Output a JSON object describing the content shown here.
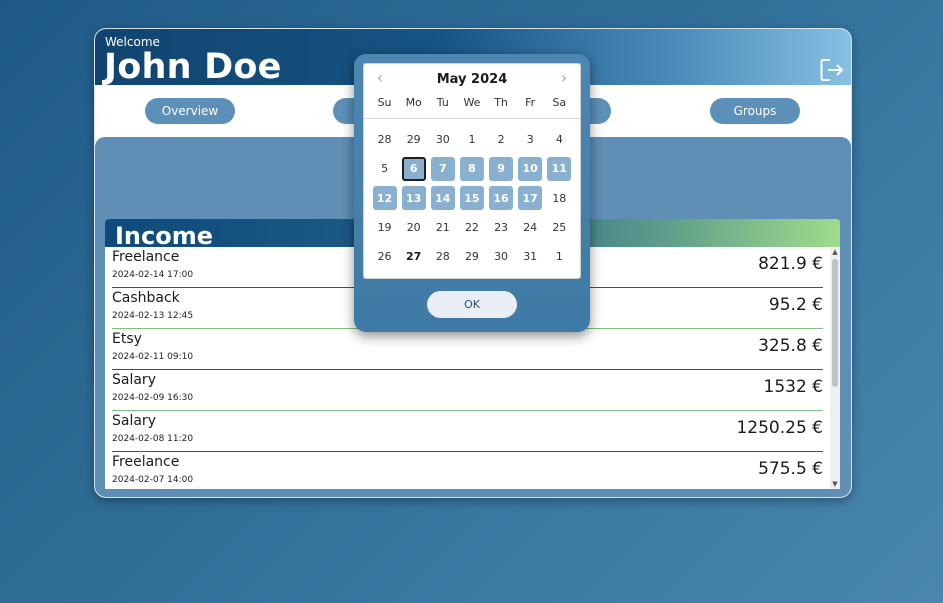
{
  "header": {
    "welcome": "Welcome",
    "username": "John Doe",
    "logout_icon": "logout-icon"
  },
  "nav": {
    "items": [
      {
        "label": "Overview"
      },
      {
        "label": ""
      },
      {
        "label": ""
      },
      {
        "label": "Groups"
      }
    ]
  },
  "income": {
    "title": "Income",
    "rows": [
      {
        "name": "Freelance",
        "date": "2024-02-14 17:00",
        "amount": "821.9 €"
      },
      {
        "name": "Cashback",
        "date": "2024-02-13 12:45",
        "amount": "95.2 €"
      },
      {
        "name": "Etsy",
        "date": "2024-02-11 09:10",
        "amount": "325.8 €"
      },
      {
        "name": "Salary",
        "date": "2024-02-09 16:30",
        "amount": "1532 €"
      },
      {
        "name": "Salary",
        "date": "2024-02-08 11:20",
        "amount": "1250.25 €"
      },
      {
        "name": "Freelance",
        "date": "2024-02-07 14:00",
        "amount": "575.5 €"
      }
    ]
  },
  "datepicker": {
    "month_label": "May 2024",
    "prev_icon": "chevron-left-icon",
    "next_icon": "chevron-right-icon",
    "weekdays": [
      "Su",
      "Mo",
      "Tu",
      "We",
      "Th",
      "Fr",
      "Sa"
    ],
    "weeks": [
      [
        "28",
        "29",
        "30",
        "1",
        "2",
        "3",
        "4"
      ],
      [
        "5",
        "6",
        "7",
        "8",
        "9",
        "10",
        "11"
      ],
      [
        "12",
        "13",
        "14",
        "15",
        "16",
        "17",
        "18"
      ],
      [
        "19",
        "20",
        "21",
        "22",
        "23",
        "24",
        "25"
      ],
      [
        "26",
        "27",
        "28",
        "29",
        "30",
        "31",
        "1"
      ]
    ],
    "selected_range": [
      "6",
      "7",
      "8",
      "9",
      "10",
      "11",
      "12",
      "13",
      "14",
      "15",
      "16",
      "17"
    ],
    "focused_day": "6",
    "today": "27",
    "ok_label": "OK"
  }
}
